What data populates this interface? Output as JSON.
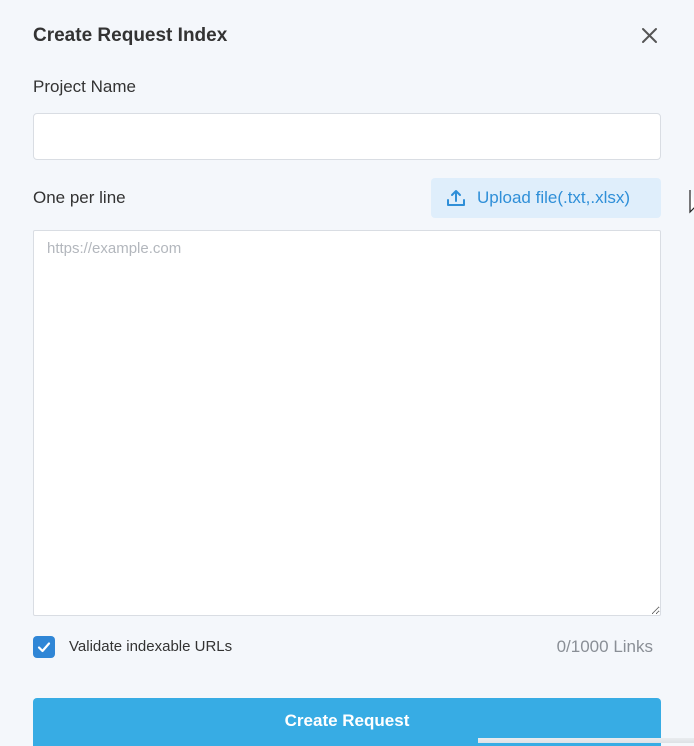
{
  "modal": {
    "title": "Create Request Index",
    "close_icon": "close-icon"
  },
  "project": {
    "label": "Project Name",
    "value": "",
    "placeholder": ""
  },
  "urls": {
    "label": "One per line",
    "upload_label": "Upload file(.txt,.xlsx)",
    "upload_icon": "upload-icon",
    "placeholder": "https://example.com",
    "value": ""
  },
  "validate": {
    "checked": true,
    "label": "Validate indexable URLs",
    "check_icon": "check-icon"
  },
  "counter": {
    "text": "0/1000 Links"
  },
  "submit": {
    "label": "Create Request"
  },
  "colors": {
    "accent": "#2f86d6",
    "primary_button": "#37ace4",
    "upload_bg": "#dfeefb",
    "upload_text": "#2f8fd8",
    "background": "#f4f7fb"
  }
}
